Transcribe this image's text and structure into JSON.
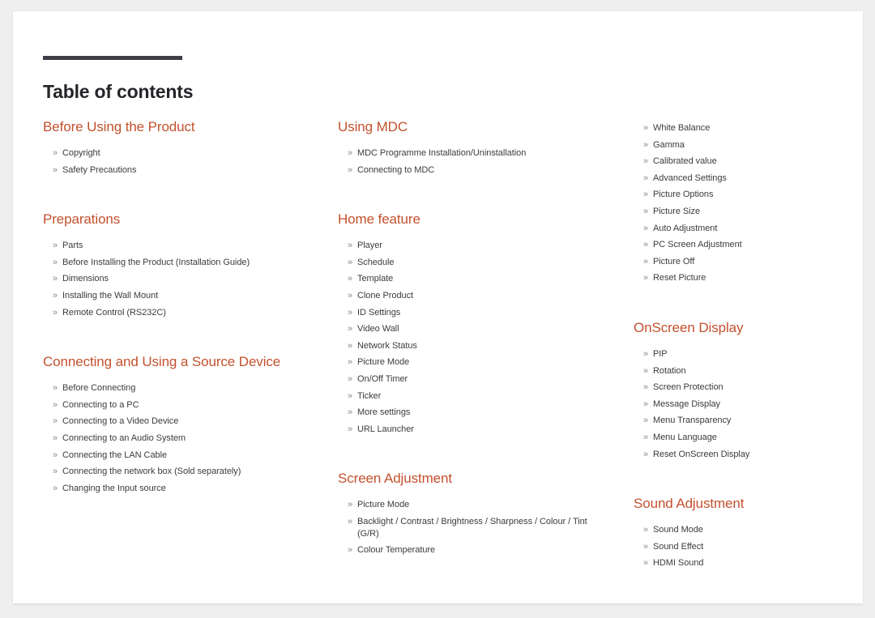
{
  "document": {
    "title": "Table of contents",
    "accent_color": "#c3512e",
    "rule_color": "#3f3d47",
    "title_color": "#262428",
    "body_text_color": "#3c3c3c",
    "bullet_glyph": "»",
    "page_background": "#ffffff",
    "canvas_background": "#efefef"
  },
  "columns": [
    {
      "id": "column-1",
      "sections": [
        {
          "heading": "Before Using the Product",
          "items": [
            "Copyright",
            "Safety Precautions"
          ]
        },
        {
          "heading": "Preparations",
          "items": [
            "Parts",
            "Before Installing the Product (Installation Guide)",
            "Dimensions",
            "Installing the Wall Mount",
            "Remote Control (RS232C)"
          ]
        },
        {
          "heading": "Connecting and Using a Source Device",
          "items": [
            "Before Connecting",
            "Connecting to a PC",
            "Connecting to a Video Device",
            "Connecting to an Audio System",
            "Connecting the LAN Cable",
            "Connecting the network box (Sold separately)",
            "Changing the Input source"
          ]
        }
      ]
    },
    {
      "id": "column-2",
      "sections": [
        {
          "heading": "Using MDC",
          "items": [
            "MDC Programme Installation/Uninstallation",
            "Connecting to MDC"
          ]
        },
        {
          "heading": "Home feature",
          "items": [
            "Player",
            "Schedule",
            "Template",
            "Clone Product",
            "ID Settings",
            "Video Wall",
            "Network Status",
            "Picture Mode",
            "On/Off Timer",
            "Ticker",
            "More settings",
            "URL Launcher"
          ]
        },
        {
          "heading": "Screen Adjustment",
          "items": [
            "Picture Mode",
            "Backlight / Contrast / Brightness / Sharpness / Colour / Tint (G/R)",
            "Colour Temperature"
          ]
        }
      ]
    },
    {
      "id": "column-3",
      "sections": [
        {
          "heading": "",
          "items": [
            "White Balance",
            "Gamma",
            "Calibrated value",
            "Advanced Settings",
            "Picture Options",
            "Picture Size",
            "Auto Adjustment",
            "PC Screen Adjustment",
            "Picture Off",
            "Reset Picture"
          ]
        },
        {
          "heading": "OnScreen Display",
          "items": [
            "PIP",
            "Rotation",
            "Screen Protection",
            "Message Display",
            "Menu Transparency",
            "Menu Language",
            "Reset OnScreen Display"
          ]
        },
        {
          "heading": "Sound Adjustment",
          "items": [
            "Sound Mode",
            "Sound Effect",
            "HDMI Sound"
          ]
        }
      ]
    }
  ]
}
